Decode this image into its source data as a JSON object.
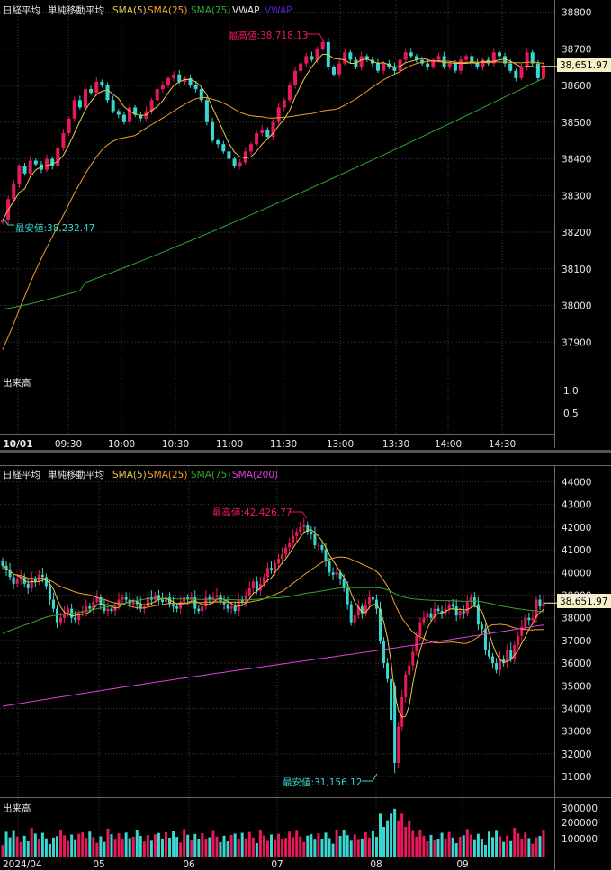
{
  "colors": {
    "up": "#e8195a",
    "down": "#3ad6d0",
    "sma5": "#e6c84a",
    "sma25": "#f0a030",
    "sma75": "#2fa82f",
    "vwap": "#5a1fd6",
    "sma200": "#e040e0",
    "grid": "#3a3a3a",
    "text": "#e8e8e8",
    "bg": "#000000"
  },
  "chart_data": [
    {
      "type": "candlestick",
      "title": "日経平均",
      "legend": [
        {
          "label": "単純移動平均",
          "color": "#e8e8e8"
        },
        {
          "label": "SMA(5)",
          "color": "#e6c84a"
        },
        {
          "label": "SMA(25)",
          "color": "#f0a030"
        },
        {
          "label": "SMA(75)",
          "color": "#2fa82f"
        },
        {
          "label": "VWAP",
          "color": "#e8e8e8"
        },
        {
          "label": "VWAP",
          "color": "#5a1fd6"
        }
      ],
      "ylim": [
        37820,
        38830
      ],
      "yticks": [
        "38800",
        "38700",
        "38600",
        "38500",
        "38400",
        "38300",
        "38200",
        "38100",
        "38000",
        "37900"
      ],
      "ytick_values": [
        38800,
        38700,
        38600,
        38500,
        38400,
        38300,
        38200,
        38100,
        38000,
        37900
      ],
      "xticks": [
        "10/01",
        "09:30",
        "10:00",
        "10:30",
        "11:00",
        "11:30",
        "13:00",
        "13:30",
        "14:00",
        "14:30"
      ],
      "high_label": "最高値:38,718.13",
      "low_label": "最安値:38,232.47",
      "high": 38718.13,
      "low": 38232.47,
      "last_label": "38,651.97",
      "last": 38651.97,
      "volume_label": "出来高",
      "volume_yticks": [
        "1.0",
        "0.5"
      ]
    },
    {
      "type": "candlestick",
      "title": "日経平均",
      "legend": [
        {
          "label": "単純移動平均",
          "color": "#e8e8e8"
        },
        {
          "label": "SMA(5)",
          "color": "#e6c84a"
        },
        {
          "label": "SMA(25)",
          "color": "#f0a030"
        },
        {
          "label": "SMA(75)",
          "color": "#2fa82f"
        },
        {
          "label": "SMA(200)",
          "color": "#e040e0"
        }
      ],
      "ylim": [
        30500,
        44400
      ],
      "yticks": [
        "44000",
        "43000",
        "42000",
        "41000",
        "40000",
        "39000",
        "38000",
        "37000",
        "36000",
        "35000",
        "34000",
        "33000",
        "32000",
        "31000"
      ],
      "ytick_values": [
        44000,
        43000,
        42000,
        41000,
        40000,
        39000,
        38000,
        37000,
        36000,
        35000,
        34000,
        33000,
        32000,
        31000
      ],
      "xticks": [
        "2024/04",
        "05",
        "06",
        "07",
        "08",
        "09"
      ],
      "high_label": "最高値:42,426.77",
      "low_label": "最安値:31,156.12",
      "high": 42426.77,
      "low": 31156.12,
      "last_label": "38,651.97",
      "last": 38651.97,
      "volume_label": "出来高",
      "volume_yticks": [
        "300000",
        "200000",
        "100000"
      ]
    }
  ]
}
